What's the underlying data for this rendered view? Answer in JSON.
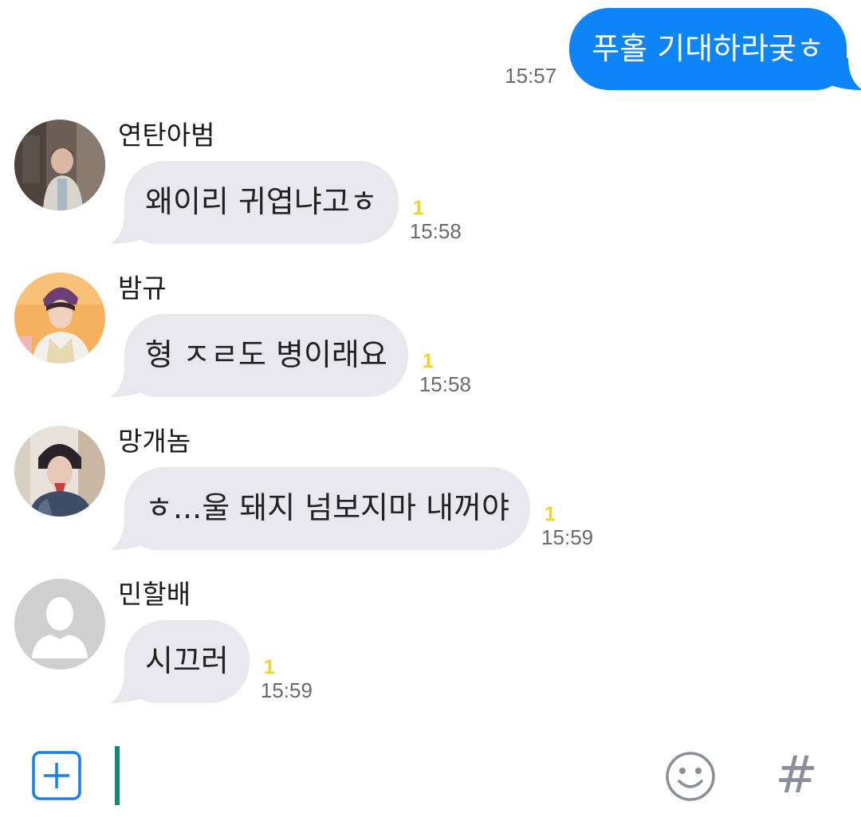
{
  "outgoing": {
    "text": "푸홀 기대하라궂ㅎ",
    "time": "15:57",
    "bubble_color": "#0d84f8"
  },
  "messages": [
    {
      "sender": "연탄아범",
      "text": "왜이리 귀엽냐고ㅎ",
      "unread": "1",
      "time": "15:58",
      "avatar": "profile-photo"
    },
    {
      "sender": "밤규",
      "text": "형 ㅈㄹ도 병이래요",
      "unread": "1",
      "time": "15:58",
      "avatar": "profile-photo"
    },
    {
      "sender": "망개놈",
      "text": "ㅎ...울 돼지 넘보지마 내꺼야",
      "unread": "1",
      "time": "15:59",
      "avatar": "profile-photo"
    },
    {
      "sender": "민할배",
      "text": "시끄러",
      "unread": "1",
      "time": "15:59",
      "avatar": "default-profile-icon"
    }
  ],
  "input_bar": {
    "plus_icon": "plus-square-icon",
    "emoji_icon": "smiley-icon",
    "hash_label": "#",
    "input_value": "",
    "accent_color": "#128b72"
  },
  "colors": {
    "incoming_bubble": "#e8e8ee",
    "unread_badge": "#f2d32b",
    "timestamp": "#6b6b6b"
  }
}
